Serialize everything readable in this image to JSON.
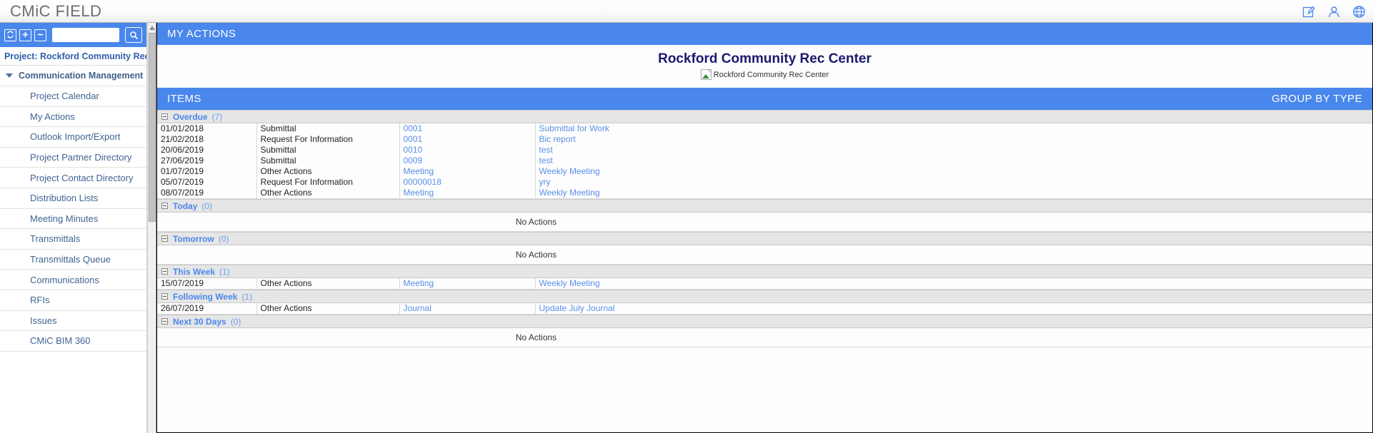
{
  "app": {
    "brand": "CMiC FIELD",
    "header_icons": [
      {
        "name": "compose-icon",
        "label": "Compose"
      },
      {
        "name": "user-icon",
        "label": "User Profile"
      },
      {
        "name": "globe-icon",
        "label": "Language"
      }
    ]
  },
  "sidebar": {
    "toolbar": {
      "refresh_label": "Refresh",
      "expand_label": "+",
      "collapse_label": "−",
      "search_value": "",
      "search_placeholder": "",
      "search_button_label": "Search"
    },
    "project_label": "Project: Rockford Community Rec Cent",
    "group": {
      "label": "Communication Management",
      "expanded": true
    },
    "items": [
      {
        "label": "Project Calendar"
      },
      {
        "label": "My Actions"
      },
      {
        "label": "Outlook Import/Export"
      },
      {
        "label": "Project Partner Directory"
      },
      {
        "label": "Project Contact Directory"
      },
      {
        "label": "Distribution Lists"
      },
      {
        "label": "Meeting Minutes"
      },
      {
        "label": "Transmittals"
      },
      {
        "label": "Transmittals Queue"
      },
      {
        "label": "Communications"
      },
      {
        "label": "RFIs"
      },
      {
        "label": "Issues"
      },
      {
        "label": "CMiC BIM 360"
      }
    ]
  },
  "main": {
    "page_band_title": "MY ACTIONS",
    "project_title": "Rockford Community Rec Center",
    "project_image_alt": "Rockford Community Rec Center",
    "items_band_title": "ITEMS",
    "group_by_label": "GROUP BY TYPE",
    "empty_text": "No Actions",
    "groups": [
      {
        "name": "Overdue",
        "count": "(7)",
        "rows": [
          {
            "date": "01/01/2018",
            "type": "Submittal",
            "ref": "0001",
            "desc": "Submittal for Work"
          },
          {
            "date": "21/02/2018",
            "type": "Request For Information",
            "ref": "0001",
            "desc": "Bic report"
          },
          {
            "date": "20/06/2019",
            "type": "Submittal",
            "ref": "0010",
            "desc": "test"
          },
          {
            "date": "27/06/2019",
            "type": "Submittal",
            "ref": "0009",
            "desc": "test"
          },
          {
            "date": "01/07/2019",
            "type": "Other Actions",
            "ref": "Meeting",
            "desc": "Weekly Meeting"
          },
          {
            "date": "05/07/2019",
            "type": "Request For Information",
            "ref": "00000018",
            "desc": "yry"
          },
          {
            "date": "08/07/2019",
            "type": "Other Actions",
            "ref": "Meeting",
            "desc": "Weekly Meeting"
          }
        ]
      },
      {
        "name": "Today",
        "count": "(0)",
        "rows": []
      },
      {
        "name": "Tomorrow",
        "count": "(0)",
        "rows": []
      },
      {
        "name": "This Week",
        "count": "(1)",
        "rows": [
          {
            "date": "15/07/2019",
            "type": "Other Actions",
            "ref": "Meeting",
            "desc": "Weekly Meeting"
          }
        ]
      },
      {
        "name": "Following Week",
        "count": "(1)",
        "rows": [
          {
            "date": "26/07/2019",
            "type": "Other Actions",
            "ref": "Journal",
            "desc": "Update July Journal"
          }
        ]
      },
      {
        "name": "Next 30 Days",
        "count": "(0)",
        "rows": []
      }
    ]
  },
  "colors": {
    "accent_blue": "#4a87ec",
    "link_blue": "#5b8fe8",
    "title_navy": "#1a1a6e",
    "sidebar_text": "#3f6493"
  }
}
